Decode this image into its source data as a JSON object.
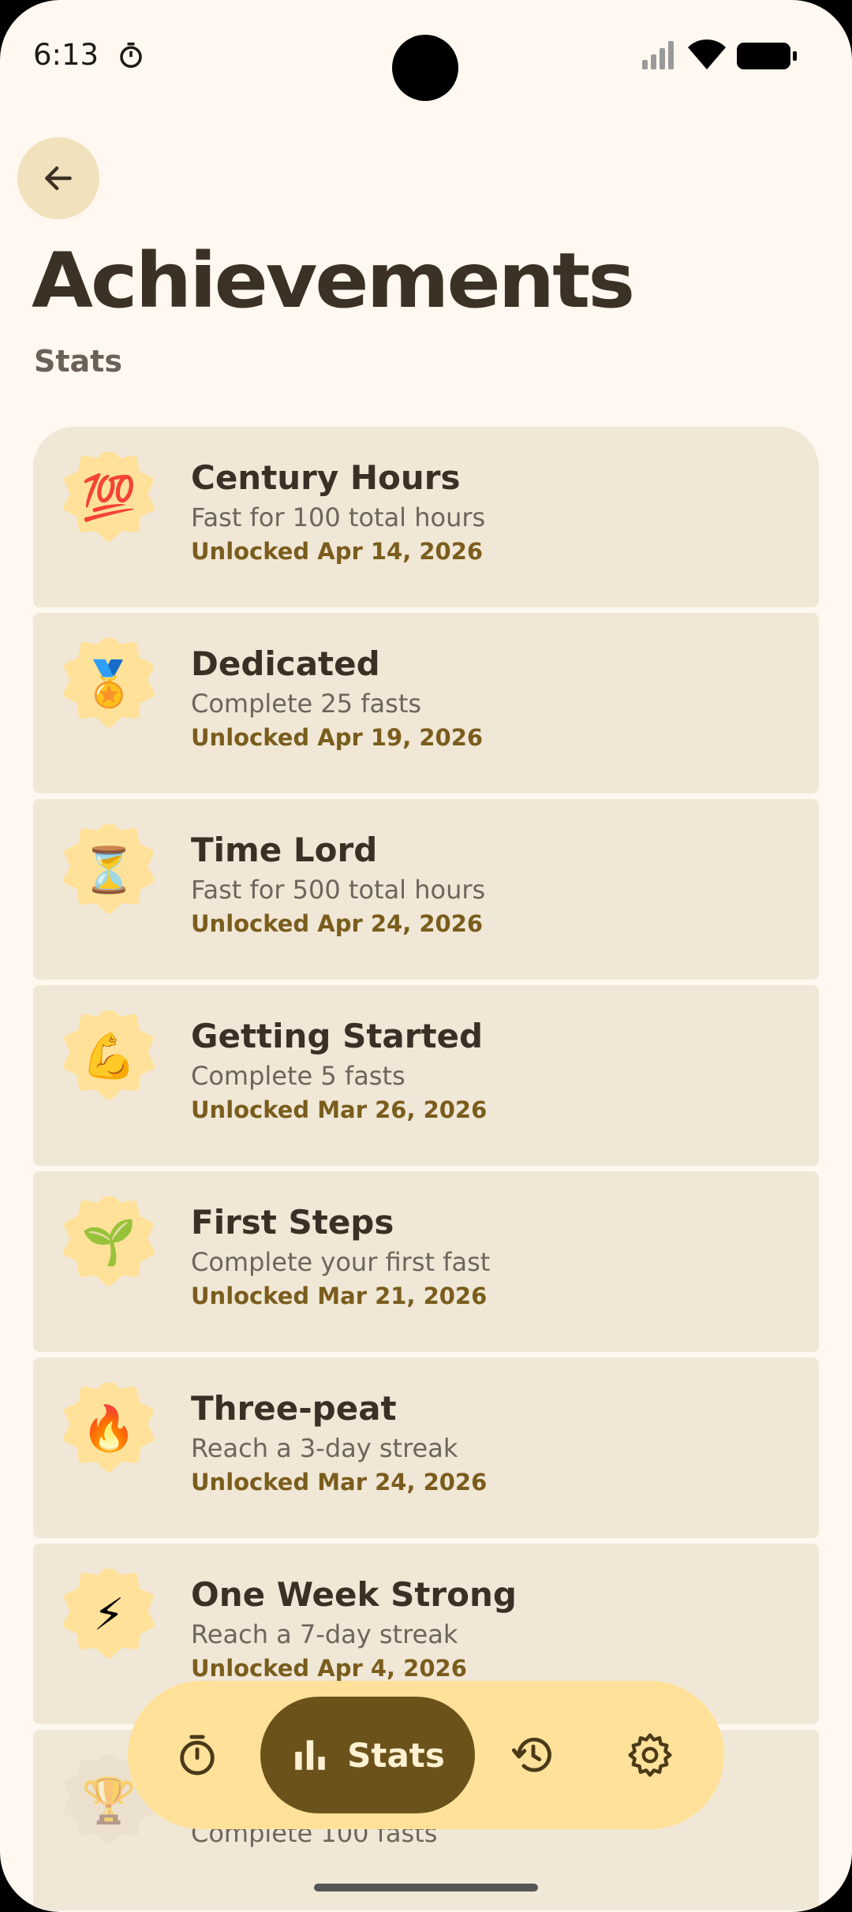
{
  "status_bar": {
    "time": "6:13"
  },
  "header": {
    "title": "Achievements",
    "subtitle": "Stats"
  },
  "achievements": [
    {
      "icon": "hundred-points-icon",
      "emoji": "💯",
      "title": "Century Hours",
      "description": "Fast for 100 total hours",
      "unlocked": "Unlocked Apr 14, 2026"
    },
    {
      "icon": "medal-icon",
      "emoji": "🏅",
      "title": "Dedicated",
      "description": "Complete 25 fasts",
      "unlocked": "Unlocked Apr 19, 2026"
    },
    {
      "icon": "hourglass-icon",
      "emoji": "⏳",
      "title": "Time Lord",
      "description": "Fast for 500 total hours",
      "unlocked": "Unlocked Apr 24, 2026"
    },
    {
      "icon": "flexed-biceps-icon",
      "emoji": "💪",
      "title": "Getting Started",
      "description": "Complete 5 fasts",
      "unlocked": "Unlocked Mar 26, 2026"
    },
    {
      "icon": "seedling-icon",
      "emoji": "🌱",
      "title": "First Steps",
      "description": "Complete your first fast",
      "unlocked": "Unlocked Mar 21, 2026"
    },
    {
      "icon": "fire-icon",
      "emoji": "🔥",
      "title": "Three-peat",
      "description": "Reach a 3-day streak",
      "unlocked": "Unlocked Mar 24, 2026"
    },
    {
      "icon": "lightning-icon",
      "emoji": "⚡",
      "title": "One Week Strong",
      "description": "Reach a 7-day streak",
      "unlocked": "Unlocked Apr 4, 2026"
    },
    {
      "icon": "trophy-icon",
      "emoji": "🏆",
      "title": "",
      "description": "Complete 100 fasts",
      "unlocked": ""
    }
  ],
  "nav": {
    "items": [
      {
        "icon": "timer-icon"
      },
      {
        "icon": "bar-chart-icon",
        "label": "Stats",
        "active": true
      },
      {
        "icon": "history-icon"
      },
      {
        "icon": "gear-icon"
      }
    ]
  },
  "colors": {
    "background": "#FFF8F0",
    "card": "#F0E7D6",
    "accent": "#6B521A",
    "nav": "#FFE19A",
    "badge": "#FFE19A"
  }
}
